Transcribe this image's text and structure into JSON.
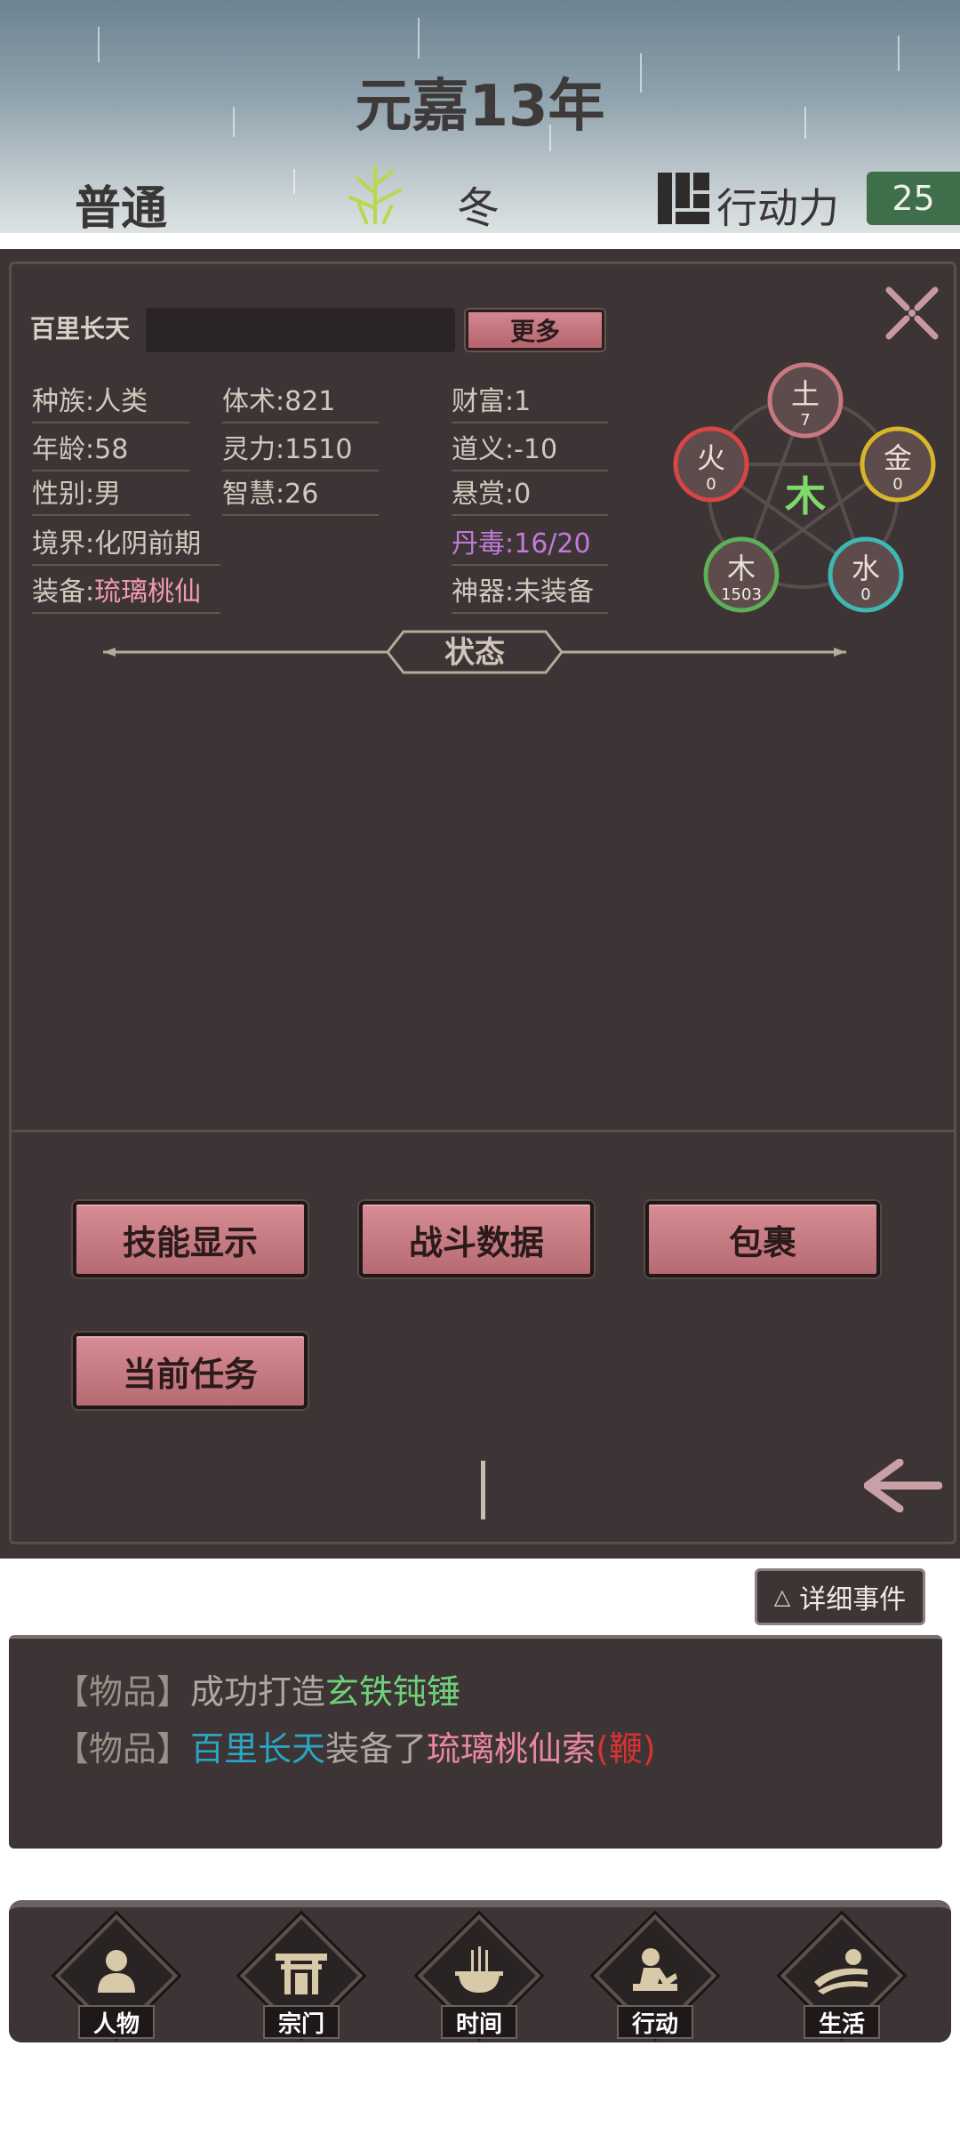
{
  "header": {
    "era": "元嘉13年",
    "difficulty": "普通",
    "season": "冬",
    "action_points_label": "行动力",
    "action_points": "25"
  },
  "character": {
    "name": "百里长天",
    "more_button": "更多",
    "stats": {
      "race": "种族:人类",
      "age": "年龄:58",
      "gender": "性别:男",
      "realm": "境界:化阴前期",
      "equip_label": "装备:",
      "equip_value": "琉璃桃仙",
      "body": "体术:821",
      "spirit": "灵力:1510",
      "wisdom": "智慧:26",
      "wealth": "财富:1",
      "morality": "道义:-10",
      "bounty": "悬赏:0",
      "pill_poison": "丹毒:16/20",
      "artifact": "神器:未装备"
    },
    "five_elements": {
      "center": "木",
      "earth": {
        "name": "土",
        "value": "7",
        "color": "#c8797f"
      },
      "fire": {
        "name": "火",
        "value": "0",
        "color": "#d84545"
      },
      "metal": {
        "name": "金",
        "value": "0",
        "color": "#d8b52a"
      },
      "wood": {
        "name": "木",
        "value": "1503",
        "color": "#5fae58"
      },
      "water": {
        "name": "水",
        "value": "0",
        "color": "#3fb7b2"
      }
    },
    "status_title": "状态"
  },
  "actions": {
    "skills": "技能显示",
    "battle": "战斗数据",
    "bag": "包裹",
    "quest": "当前任务"
  },
  "events": {
    "detail_button": "详细事件",
    "detail_icon": "△",
    "lines": [
      {
        "tag": "【物品】",
        "parts": [
          {
            "t": "成功打造",
            "c": "ev-text"
          },
          {
            "t": "玄铁钝锤",
            "c": "ev-green"
          }
        ]
      },
      {
        "tag": "【物品】",
        "parts": [
          {
            "t": "百里长天",
            "c": "ev-blue"
          },
          {
            "t": "装备了",
            "c": "ev-text"
          },
          {
            "t": "琉璃桃仙索",
            "c": "ev-pink"
          },
          {
            "t": "(鞭)",
            "c": "ev-red"
          }
        ]
      }
    ]
  },
  "nav": {
    "character": "人物",
    "sect": "宗门",
    "time": "时间",
    "action": "行动",
    "life": "生活"
  },
  "colors": {
    "panel_bg": "#3d3535",
    "button_pink": "#c97880",
    "ap_green": "#3f6f4a",
    "pill_poison_purple": "#c07ad8"
  }
}
